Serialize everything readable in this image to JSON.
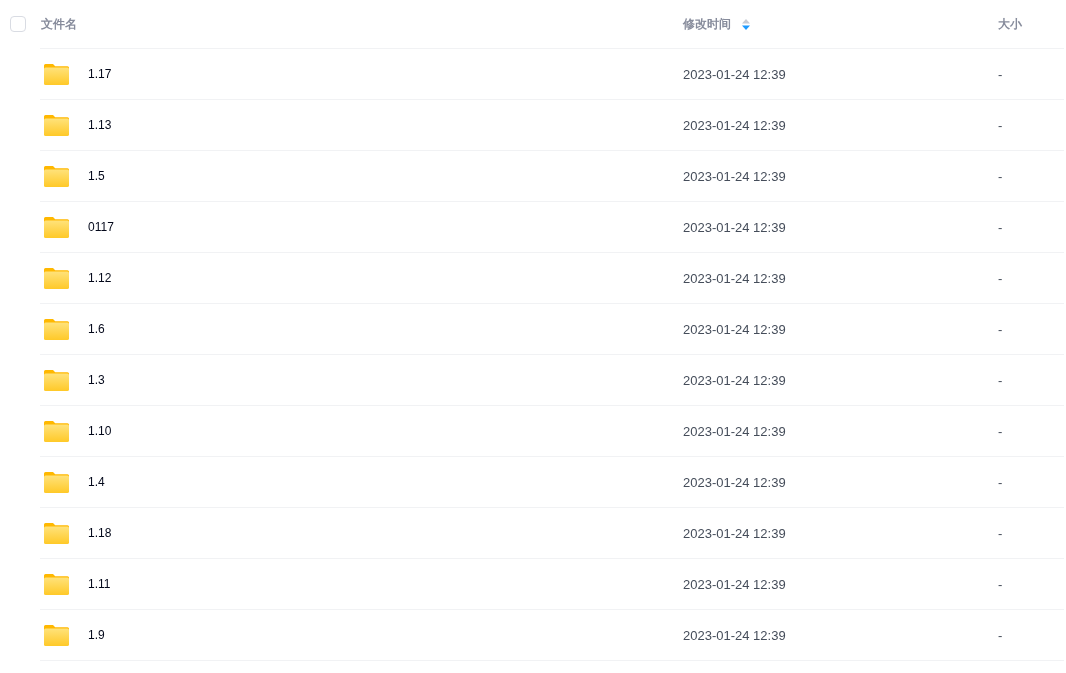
{
  "header": {
    "checkbox": {
      "checked": false
    },
    "columns": [
      {
        "label": "文件名"
      },
      {
        "label": "修改时间",
        "sort_descending": true
      },
      {
        "label": "大小"
      }
    ]
  },
  "rows": [
    {
      "name": "1.17",
      "modified": "2023-01-24 12:39",
      "size": "-"
    },
    {
      "name": "1.13",
      "modified": "2023-01-24 12:39",
      "size": "-"
    },
    {
      "name": "1.5",
      "modified": "2023-01-24 12:39",
      "size": "-"
    },
    {
      "name": "0117",
      "modified": "2023-01-24 12:39",
      "size": "-"
    },
    {
      "name": "1.12",
      "modified": "2023-01-24 12:39",
      "size": "-"
    },
    {
      "name": "1.6",
      "modified": "2023-01-24 12:39",
      "size": "-"
    },
    {
      "name": "1.3",
      "modified": "2023-01-24 12:39",
      "size": "-"
    },
    {
      "name": "1.10",
      "modified": "2023-01-24 12:39",
      "size": "-"
    },
    {
      "name": "1.4",
      "modified": "2023-01-24 12:39",
      "size": "-"
    },
    {
      "name": "1.18",
      "modified": "2023-01-24 12:39",
      "size": "-"
    },
    {
      "name": "1.11",
      "modified": "2023-01-24 12:39",
      "size": "-"
    },
    {
      "name": "1.9",
      "modified": "2023-01-24 12:39",
      "size": "-"
    }
  ]
}
